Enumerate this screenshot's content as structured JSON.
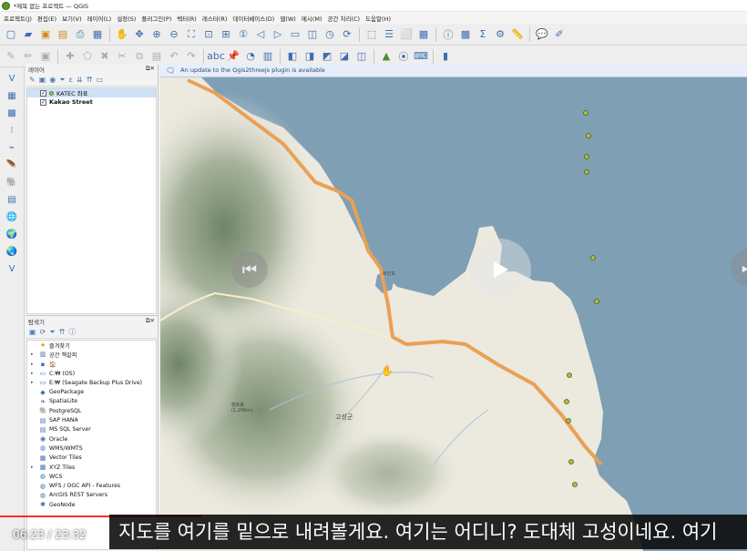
{
  "window": {
    "title": "*제목 없는 프로젝트 — QGIS"
  },
  "menu": [
    "프로젝트(J)",
    "편집(E)",
    "보기(V)",
    "레이어(L)",
    "설정(S)",
    "플러그인(P)",
    "벡터(R)",
    "래스터(R)",
    "데이터베이스(D)",
    "웹(W)",
    "메시(M)",
    "공간 처리(C)",
    "도움말(H)"
  ],
  "toolbar_icons_row1": [
    "new-project-icon",
    "open-folder-icon",
    "save-icon",
    "save-as-icon",
    "print-layout-icon",
    "layout-manager-icon",
    "pan-icon",
    "pan-to-selection-icon",
    "zoom-in-icon",
    "zoom-out-icon",
    "zoom-full-icon",
    "zoom-to-selection-icon",
    "zoom-to-layer-icon",
    "zoom-native-icon",
    "zoom-last-icon",
    "zoom-next-icon",
    "new-map-view-icon",
    "new-3d-map-icon",
    "temporal-controller-icon",
    "refresh-icon",
    "select-features-icon",
    "select-by-value-icon",
    "deselect-icon",
    "open-attribute-table-icon",
    "identify-icon",
    "field-calculator-icon",
    "statistics-icon",
    "toolbox-icon",
    "measure-icon",
    "map-tips-icon",
    "annotation-icon"
  ],
  "toolbar_icons_row2": [
    "current-edits-icon",
    "toggle-editing-icon",
    "save-edits-icon",
    "add-feature-icon",
    "vertex-tool-icon",
    "delete-selected-icon",
    "cut-features-icon",
    "copy-features-icon",
    "paste-features-icon",
    "undo-icon",
    "redo-icon",
    "label-toolbar-icon",
    "label-pin-icon",
    "diagram-icon",
    "layer-styling-icon",
    "plugin-a-icon",
    "plugin-b-icon",
    "plugin-c-icon",
    "plugin-d-icon",
    "plugin-e-icon",
    "georeferencer-icon",
    "gps-icon",
    "python-console-icon",
    "atlas-icon"
  ],
  "left_toolbar_icons": [
    "add-vector-layer-icon",
    "add-raster-layer-icon",
    "add-mesh-layer-icon",
    "add-delimited-text-icon",
    "add-gps-layer-icon",
    "add-spatialite-icon",
    "add-postgis-icon",
    "add-mssql-icon",
    "add-wms-icon",
    "add-wfs-icon",
    "add-wcs-icon",
    "add-virtual-layer-icon"
  ],
  "layers_panel": {
    "title": "레이어",
    "items": [
      {
        "name": "KATEC 좌표",
        "checked": true,
        "selected": true,
        "type": "point"
      },
      {
        "name": "Kakao Street",
        "checked": true,
        "selected": false,
        "type": "raster"
      }
    ]
  },
  "browser_panel": {
    "title": "탐색기",
    "items": [
      {
        "label": "즐겨찾기",
        "icon": "star-icon",
        "expand": false
      },
      {
        "label": "공간 책갈피",
        "icon": "bookmark-icon",
        "expand": true
      },
      {
        "label": "🏠",
        "icon": "home-icon",
        "expand": true
      },
      {
        "label": "C:₩ (OS)",
        "icon": "drive-icon",
        "expand": true
      },
      {
        "label": "E:₩ (Seagate Backup Plus Drive)",
        "icon": "drive-icon",
        "expand": true
      },
      {
        "label": "GeoPackage",
        "icon": "geopackage-icon",
        "expand": false
      },
      {
        "label": "SpatiaLite",
        "icon": "spatialite-icon",
        "expand": false
      },
      {
        "label": "PostgreSQL",
        "icon": "postgresql-icon",
        "expand": false
      },
      {
        "label": "SAP HANA",
        "icon": "sap-hana-icon",
        "expand": false
      },
      {
        "label": "MS SQL Server",
        "icon": "mssql-icon",
        "expand": false
      },
      {
        "label": "Oracle",
        "icon": "oracle-icon",
        "expand": false
      },
      {
        "label": "WMS/WMTS",
        "icon": "wms-icon",
        "expand": false
      },
      {
        "label": "Vector Tiles",
        "icon": "vector-tiles-icon",
        "expand": false
      },
      {
        "label": "XYZ Tiles",
        "icon": "xyz-tiles-icon",
        "expand": true
      },
      {
        "label": "WCS",
        "icon": "wcs-icon",
        "expand": false
      },
      {
        "label": "WFS / OGC API - Features",
        "icon": "wfs-icon",
        "expand": false
      },
      {
        "label": "ArcGIS REST Servers",
        "icon": "arcgis-icon",
        "expand": false
      },
      {
        "label": "GeoNode",
        "icon": "geonode-icon",
        "expand": false
      }
    ]
  },
  "info_bar": {
    "message": "An update to the Qgis2threejs plugin is available"
  },
  "map": {
    "labels": {
      "town": "고성군",
      "lake": "화진포",
      "mountain": "향로봉\n(1,296m)"
    },
    "colors": {
      "sea": "#7f9fb5",
      "land": "#f1eee6",
      "road": "#e8a156",
      "terrain": "#8fa081",
      "river": "#aac4d6"
    }
  },
  "video": {
    "time": "06:23 / 23:32",
    "caption": "지도를 여기를 밑으로 내려볼게요. 여기는 어디니? 도대체 고성이네요. 여기",
    "progress": 0.27
  }
}
